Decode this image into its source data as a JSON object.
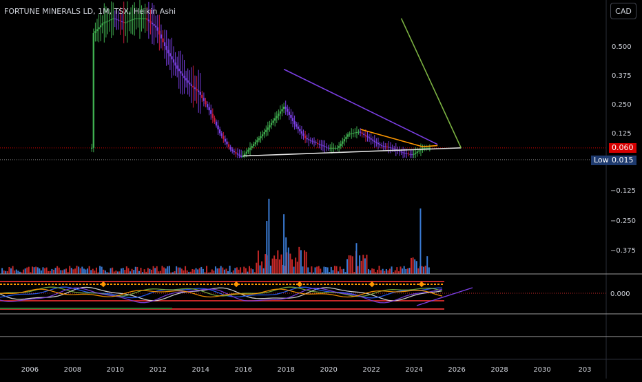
{
  "chart_title": "FORTUNE MINERALS LD, 1M, TSX, Heikin Ashi",
  "currency_label": "CAD",
  "colors": {
    "background": "#000000",
    "axis_text": "#d1d4dc",
    "candle_up": "#3fae4f",
    "candle_down": "#7b3fe4",
    "candle_mid": "#c61a3a",
    "volume_up": "#3a7bd5",
    "volume_down": "#c62828",
    "last_price_tag": "#d50000",
    "low_tag": "#1e3a6e"
  },
  "chart_data": {
    "type": "candlestick",
    "title": "FORTUNE MINERALS LD, 1M, TSX, Heikin Ashi",
    "price_axis_ticks": [
      "0.500",
      "0.375",
      "0.250",
      "0.125"
    ],
    "lower_axis_ticks": [
      "−0.125",
      "−0.250",
      "−0.375",
      "0.000"
    ],
    "x_ticks": [
      "2006",
      "2008",
      "2010",
      "2012",
      "2014",
      "2016",
      "2018",
      "2020",
      "2022",
      "2024",
      "2026",
      "2028",
      "2030",
      "203"
    ],
    "xlim": [
      2005,
      2033
    ],
    "ylim": [
      -0.45,
      0.62
    ],
    "last_price": {
      "value": "0.060",
      "label": "0.060"
    },
    "low": {
      "label": "Low",
      "value": "0.015"
    },
    "price_series": [
      [
        2009.0,
        0.55
      ],
      [
        2009.5,
        0.6
      ],
      [
        2010.0,
        0.62
      ],
      [
        2010.5,
        0.6
      ],
      [
        2011.0,
        0.62
      ],
      [
        2011.5,
        0.62
      ],
      [
        2012.0,
        0.58
      ],
      [
        2012.5,
        0.48
      ],
      [
        2013.0,
        0.4
      ],
      [
        2013.5,
        0.34
      ],
      [
        2014.0,
        0.3
      ],
      [
        2014.5,
        0.22
      ],
      [
        2015.0,
        0.12
      ],
      [
        2015.5,
        0.05
      ],
      [
        2016.0,
        0.02
      ],
      [
        2016.5,
        0.07
      ],
      [
        2017.0,
        0.12
      ],
      [
        2017.5,
        0.18
      ],
      [
        2018.0,
        0.24
      ],
      [
        2018.5,
        0.16
      ],
      [
        2019.0,
        0.1
      ],
      [
        2019.5,
        0.08
      ],
      [
        2020.0,
        0.06
      ],
      [
        2020.5,
        0.06
      ],
      [
        2021.0,
        0.12
      ],
      [
        2021.5,
        0.13
      ],
      [
        2022.0,
        0.1
      ],
      [
        2022.5,
        0.07
      ],
      [
        2023.0,
        0.06
      ],
      [
        2023.5,
        0.04
      ],
      [
        2024.0,
        0.03
      ],
      [
        2024.5,
        0.06
      ]
    ],
    "trendlines": [
      {
        "name": "descending-resistance",
        "color": "#7b3fe4",
        "points": [
          [
            2017.9,
            0.4
          ],
          [
            2025.1,
            0.075
          ]
        ]
      },
      {
        "name": "support",
        "color": "#e0e0e0",
        "points": [
          [
            2016.0,
            0.025
          ],
          [
            2026.2,
            0.06
          ]
        ]
      },
      {
        "name": "orange-wedge-upper",
        "color": "#ff9800",
        "points": [
          [
            2021.5,
            0.14
          ],
          [
            2024.4,
            0.065
          ]
        ]
      },
      {
        "name": "orange-wedge-lower",
        "color": "#ff9800",
        "points": [
          [
            2024.4,
            0.065
          ],
          [
            2025.1,
            0.07
          ]
        ]
      },
      {
        "name": "projection",
        "color": "#7cb342",
        "points": [
          [
            2023.4,
            0.62
          ],
          [
            2026.2,
            0.06
          ]
        ]
      }
    ],
    "volume_spikes": [
      [
        2017.1,
        0.55
      ],
      [
        2017.2,
        0.78
      ],
      [
        2017.9,
        0.62
      ],
      [
        2018.0,
        0.38
      ],
      [
        2021.3,
        0.32
      ],
      [
        2024.3,
        0.68
      ]
    ]
  }
}
